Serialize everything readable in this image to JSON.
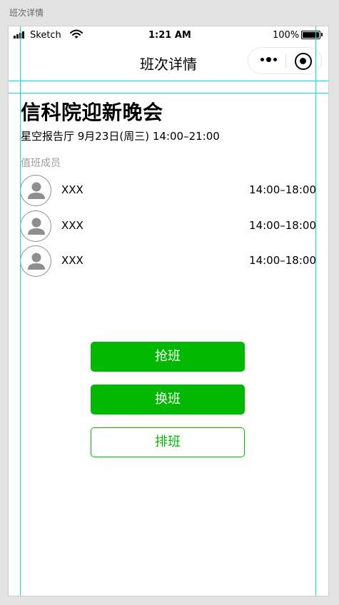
{
  "artboard": {
    "label": "班次详情"
  },
  "status_bar": {
    "carrier": "Sketch",
    "time": "1:21 AM",
    "battery": "100%"
  },
  "nav": {
    "title": "班次详情",
    "icons": [
      "more-dots-icon",
      "target-circle-icon"
    ]
  },
  "event": {
    "title": "信科院迎新晚会",
    "meta": "星空报告厅 9月23日(周三) 14:00–21:00"
  },
  "members": {
    "label": "值班成员",
    "items": [
      {
        "name": "XXX",
        "time": "14:00–18:00",
        "icon": "user-avatar-icon"
      },
      {
        "name": "XXX",
        "time": "14:00–18:00",
        "icon": "user-avatar-icon"
      },
      {
        "name": "XXX",
        "time": "14:00–18:00",
        "icon": "user-avatar-icon"
      }
    ]
  },
  "actions": {
    "grab_shift": "抢班",
    "swap_shift": "换班",
    "schedule_shift": "排班"
  },
  "colors": {
    "primary_green": "#01b901",
    "guide_cyan": "#00e1ee",
    "muted_text": "#9e9e9e"
  }
}
